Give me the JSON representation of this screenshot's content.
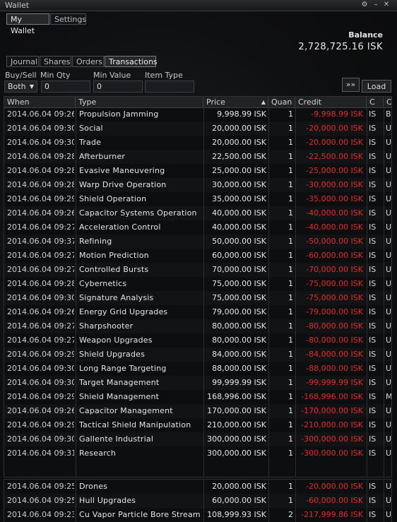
{
  "window": {
    "title": "Wallet"
  },
  "top_tabs": [
    {
      "label": "My Wallet"
    },
    {
      "label": "Settings"
    }
  ],
  "balance": {
    "label": "Balance",
    "value": "2,728,725.16 ISK"
  },
  "sub_tabs": [
    {
      "label": "Journal"
    },
    {
      "label": "Shares"
    },
    {
      "label": "Orders"
    },
    {
      "label": "Transactions"
    }
  ],
  "filters": {
    "buy_sell_label": "Buy/Sell",
    "buy_sell_value": "Both",
    "min_qty_label": "Min Qty",
    "min_qty_value": "0",
    "min_value_label": "Min Value",
    "min_value_value": "0",
    "item_type_label": "Item Type",
    "item_type_value": "",
    "load_label": "Load",
    "arrow_label": "»»"
  },
  "columns": {
    "when": "When",
    "type": "Type",
    "price": "Price",
    "qty": "Quan",
    "credit": "Credit",
    "c": "C",
    "c2": "C"
  },
  "rows": [
    {
      "when": "2014.06.04  09:26",
      "type": "Propulsion Jamming",
      "price": "9,998.99 ISK",
      "qty": "1",
      "credit": "-9,998.99 ISK",
      "c": "IS",
      "c2": "B"
    },
    {
      "when": "2014.06.04  09:30",
      "type": "Social",
      "price": "20,000.00 ISK",
      "qty": "1",
      "credit": "-20,000.00 ISK",
      "c": "IS",
      "c2": "U"
    },
    {
      "when": "2014.06.04  09:30",
      "type": "Trade",
      "price": "20,000.00 ISK",
      "qty": "1",
      "credit": "-20,000.00 ISK",
      "c": "IS",
      "c2": "U"
    },
    {
      "when": "2014.06.04  09:28",
      "type": "Afterburner",
      "price": "22,500.00 ISK",
      "qty": "1",
      "credit": "-22,500.00 ISK",
      "c": "IS",
      "c2": "U"
    },
    {
      "when": "2014.06.04  09:28",
      "type": "Evasive Maneuvering",
      "price": "25,000.00 ISK",
      "qty": "1",
      "credit": "-25,000.00 ISK",
      "c": "IS",
      "c2": "U"
    },
    {
      "when": "2014.06.04  09:28",
      "type": "Warp Drive Operation",
      "price": "30,000.00 ISK",
      "qty": "1",
      "credit": "-30,000.00 ISK",
      "c": "IS",
      "c2": "U"
    },
    {
      "when": "2014.06.04  09:29",
      "type": "Shield Operation",
      "price": "35,000.00 ISK",
      "qty": "1",
      "credit": "-35,000.00 ISK",
      "c": "IS",
      "c2": "U"
    },
    {
      "when": "2014.06.04  09:26",
      "type": "Capacitor Systems Operation",
      "price": "40,000.00 ISK",
      "qty": "1",
      "credit": "-40,000.00 ISK",
      "c": "IS",
      "c2": "U"
    },
    {
      "when": "2014.06.04  09:27",
      "type": "Acceleration Control",
      "price": "40,000.00 ISK",
      "qty": "1",
      "credit": "-40,000.00 ISK",
      "c": "IS",
      "c2": "U"
    },
    {
      "when": "2014.06.04  09:37",
      "type": "Refining",
      "price": "50,000.00 ISK",
      "qty": "1",
      "credit": "-50,000.00 ISK",
      "c": "IS",
      "c2": "U"
    },
    {
      "when": "2014.06.04  09:27",
      "type": "Motion Prediction",
      "price": "60,000.00 ISK",
      "qty": "1",
      "credit": "-60,000.00 ISK",
      "c": "IS",
      "c2": "U"
    },
    {
      "when": "2014.06.04  09:27",
      "type": "Controlled Bursts",
      "price": "70,000.00 ISK",
      "qty": "1",
      "credit": "-70,000.00 ISK",
      "c": "IS",
      "c2": "U"
    },
    {
      "when": "2014.06.04  09:28",
      "type": "Cybernetics",
      "price": "75,000.00 ISK",
      "qty": "1",
      "credit": "-75,000.00 ISK",
      "c": "IS",
      "c2": "U"
    },
    {
      "when": "2014.06.04  09:30",
      "type": "Signature Analysis",
      "price": "75,000.00 ISK",
      "qty": "1",
      "credit": "-75,000.00 ISK",
      "c": "IS",
      "c2": "U"
    },
    {
      "when": "2014.06.04  09:26",
      "type": "Energy Grid Upgrades",
      "price": "79,000.00 ISK",
      "qty": "1",
      "credit": "-79,000.00 ISK",
      "c": "IS",
      "c2": "U"
    },
    {
      "when": "2014.06.04  09:27",
      "type": "Sharpshooter",
      "price": "80,000.00 ISK",
      "qty": "1",
      "credit": "-80,000.00 ISK",
      "c": "IS",
      "c2": "U"
    },
    {
      "when": "2014.06.04  09:27",
      "type": "Weapon Upgrades",
      "price": "80,000.00 ISK",
      "qty": "1",
      "credit": "-80,000.00 ISK",
      "c": "IS",
      "c2": "U"
    },
    {
      "when": "2014.06.04  09:29",
      "type": "Shield Upgrades",
      "price": "84,000.00 ISK",
      "qty": "1",
      "credit": "-84,000.00 ISK",
      "c": "IS",
      "c2": "U"
    },
    {
      "when": "2014.06.04  09:30",
      "type": "Long Range Targeting",
      "price": "88,000.00 ISK",
      "qty": "1",
      "credit": "-88,000.00 ISK",
      "c": "IS",
      "c2": "U"
    },
    {
      "when": "2014.06.04  09:30",
      "type": "Target Management",
      "price": "99,999.99 ISK",
      "qty": "1",
      "credit": "-99,999.99 ISK",
      "c": "IS",
      "c2": "U"
    },
    {
      "when": "2014.06.04  09:29",
      "type": "Shield Management",
      "price": "168,996.00 ISK",
      "qty": "1",
      "credit": "-168,996.00 ISK",
      "c": "IS",
      "c2": "M"
    },
    {
      "when": "2014.06.04  09:26",
      "type": "Capacitor Management",
      "price": "170,000.00 ISK",
      "qty": "1",
      "credit": "-170,000.00 ISK",
      "c": "IS",
      "c2": "U"
    },
    {
      "when": "2014.06.04  09:29",
      "type": "Tactical Shield Manipulation",
      "price": "210,000.00 ISK",
      "qty": "1",
      "credit": "-210,000.00 ISK",
      "c": "IS",
      "c2": "U"
    },
    {
      "when": "2014.06.04  09:30",
      "type": "Gallente Industrial",
      "price": "300,000.00 ISK",
      "qty": "1",
      "credit": "-300,000.00 ISK",
      "c": "IS",
      "c2": "U"
    },
    {
      "when": "2014.06.04  09:31",
      "type": "Research",
      "price": "300,000.00 ISK",
      "qty": "1",
      "credit": "-300,000.00 ISK",
      "c": "IS",
      "c2": "U"
    }
  ],
  "rows2": [
    {
      "when": "2014.06.04  09:25",
      "type": "Drones",
      "price": "20,000.00 ISK",
      "qty": "1",
      "credit": "-20,000.00 ISK",
      "c": "IS",
      "c2": "U"
    },
    {
      "when": "2014.06.04  09:25",
      "type": "Hull Upgrades",
      "price": "60,000.00 ISK",
      "qty": "1",
      "credit": "-60,000.00 ISK",
      "c": "IS",
      "c2": "U"
    },
    {
      "when": "2014.06.04  09:23",
      "type": "Cu Vapor Particle Bore Stream I",
      "price": "108,999.93 ISK",
      "qty": "2",
      "credit": "-217,999.86 ISK",
      "c": "IS",
      "c2": "U"
    }
  ]
}
